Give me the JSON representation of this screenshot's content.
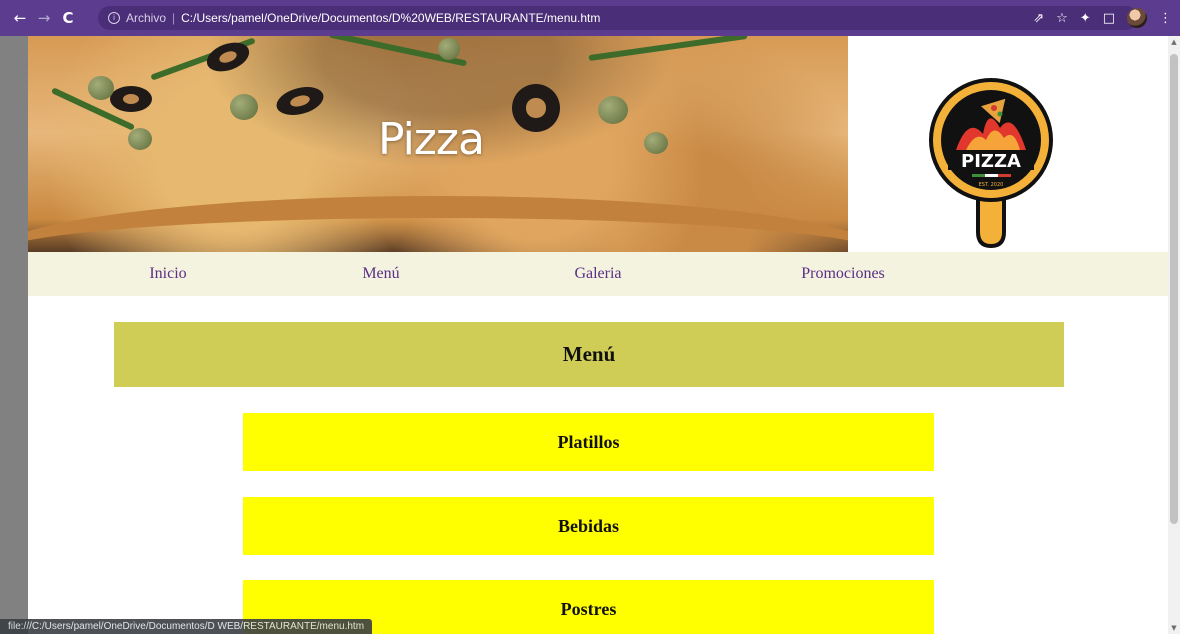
{
  "browser": {
    "scheme_label": "Archivo",
    "url": "C:/Users/pamel/OneDrive/Documentos/D%20WEB/RESTAURANTE/menu.htm",
    "back_icon": "←",
    "forward_icon": "→",
    "reload_icon": "C",
    "info_icon": "ⓘ",
    "share_icon": "⇗",
    "star_icon": "☆",
    "extensions_icon": "✦",
    "sidepanel_icon": "□",
    "menu_icon": "⋮",
    "status_url": "file:///C:/Users/pamel/OneDrive/Documentos/D WEB/RESTAURANTE/menu.htm"
  },
  "header": {
    "banner_title": "Pizza",
    "logo_text": "PIZZA",
    "logo_est": "EST. 2020"
  },
  "nav": {
    "items": [
      {
        "label": "Inicio"
      },
      {
        "label": "Menú"
      },
      {
        "label": "Galeria"
      },
      {
        "label": "Promociones"
      }
    ]
  },
  "main": {
    "section_title": "Menú",
    "categories": [
      {
        "label": "Platillos"
      },
      {
        "label": "Bebidas"
      },
      {
        "label": "Postres"
      }
    ]
  },
  "colors": {
    "chrome": "#5b3c8f",
    "nav_bar": "#f4f3df",
    "nav_link": "#5a2f86",
    "section_header": "#cfcd55",
    "category_button": "#ffff00"
  }
}
